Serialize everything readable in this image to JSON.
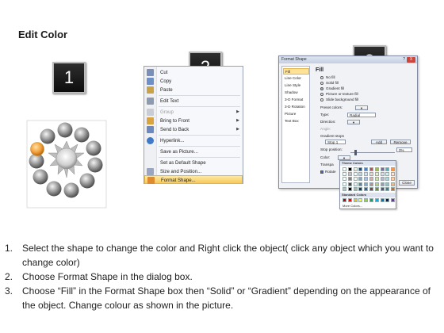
{
  "title": "Edit Color",
  "badges": [
    "1",
    "2",
    "3"
  ],
  "context_menu": {
    "items": [
      {
        "label": "Cut",
        "icon": "scissors-icon"
      },
      {
        "label": "Copy",
        "icon": "copy-icon"
      },
      {
        "label": "Paste",
        "icon": "paste-icon"
      },
      {
        "label": "Edit Text",
        "icon": "edit-text-icon"
      },
      {
        "label": "Group",
        "icon": "group-icon",
        "disabled": true,
        "submenu": true
      },
      {
        "label": "Bring to Front",
        "icon": "bring-front-icon",
        "submenu": true
      },
      {
        "label": "Send to Back",
        "icon": "send-back-icon",
        "submenu": true
      },
      {
        "label": "Hyperlink...",
        "icon": "hyperlink-icon"
      },
      {
        "label": "Save as Picture...",
        "icon": ""
      },
      {
        "label": "Set as Default Shape",
        "icon": ""
      },
      {
        "label": "Size and Position...",
        "icon": "size-position-icon"
      },
      {
        "label": "Format Shape...",
        "icon": "format-shape-icon",
        "active": true
      }
    ]
  },
  "format_dialog": {
    "title": "Format Shape",
    "nav": [
      "Fill",
      "Line Color",
      "Line Style",
      "Shadow",
      "3-D Format",
      "3-D Rotation",
      "Picture",
      "Text Box"
    ],
    "selected_nav": "Fill",
    "heading": "Fill",
    "fill_options": [
      "No fill",
      "Solid fill",
      "Gradient fill",
      "Picture or texture fill",
      "Slide background fill"
    ],
    "selected_fill": "Gradient fill",
    "preset_colors_label": "Preset colors:",
    "type_label": "Type:",
    "type_value": "Radial",
    "direction_label": "Direction:",
    "angle_label": "Angle:",
    "gradient_stops_label": "Gradient stops",
    "stop_value": "Stop 1",
    "add_label": "Add",
    "remove_label": "Remove",
    "stop_position_label": "Stop position:",
    "stop_position_value": "0%",
    "color_label": "Color:",
    "transparency_label": "Transpa",
    "rotate_label": "Rotate",
    "close_label": "Close",
    "help_icon": "?",
    "close_icon": "X",
    "palette": {
      "theme_label": "Theme Colors",
      "standard_label": "Standard Colors",
      "more_label": "More Colors...",
      "theme_top": [
        "#ffffff",
        "#000000",
        "#eeece1",
        "#1f497d",
        "#4f81bd",
        "#c0504d",
        "#9bbb59",
        "#8064a2",
        "#4bacc6",
        "#f79646"
      ],
      "standard": [
        "#c00000",
        "#ff0000",
        "#ffc000",
        "#ffff00",
        "#92d050",
        "#00b050",
        "#00b0f0",
        "#0070c0",
        "#002060",
        "#7030a0"
      ]
    }
  },
  "instructions": [
    {
      "num": "1.",
      "text": "Select the shape to change the color and Right click the object( click any object which you want to change color)"
    },
    {
      "num": "2.",
      "text": "Choose Format Shape in the dialog box."
    },
    {
      "num": "3.",
      "text": "Choose “Fill” in the Format Shape box then “Solid” or “Gradient” depending on the appearance of the object. Change colour as shown in the picture."
    }
  ],
  "colors": {
    "highlight": "#f7c95a",
    "selected_circle": "#f2a13a",
    "circle_gray": "#8e8e8e"
  }
}
